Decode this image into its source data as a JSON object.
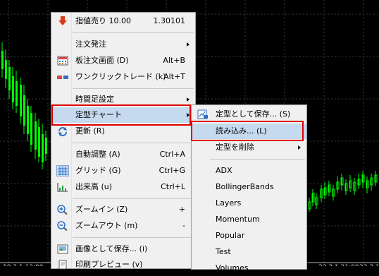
{
  "colors": {
    "chart_bg": "#000000",
    "candle": "#00ff00",
    "menu_bg": "#f0f0f0",
    "highlight": "#c5d9ef",
    "callout": "#e00000"
  },
  "main_menu": {
    "items": [
      {
        "label": "指値売り 10.00",
        "shortcut": "1.30101",
        "icon": "red-down-arrow-icon"
      },
      {
        "label": "注文発注",
        "submenu": true
      },
      {
        "label": "板注文画面 (D)",
        "shortcut": "Alt+B",
        "icon": "order-board-icon"
      },
      {
        "label": "ワンクリックトレード (k)",
        "shortcut": "Alt+T",
        "icon": "one-click-trade-icon"
      },
      {
        "label": "時間足設定",
        "submenu": true
      },
      {
        "label": "定型チャート",
        "submenu": true,
        "highlighted": true
      },
      {
        "label": "更新 (R)",
        "icon": "refresh-icon"
      },
      {
        "label": "自動調整 (A)",
        "shortcut": "Ctrl+A"
      },
      {
        "label": "グリッド (G)",
        "shortcut": "Ctrl+G",
        "icon": "grid-icon"
      },
      {
        "label": "出来高 (u)",
        "shortcut": "Ctrl+L",
        "icon": "volume-icon"
      },
      {
        "label": "ズームイン (Z)",
        "shortcut": "+",
        "icon": "zoom-in-icon"
      },
      {
        "label": "ズームアウト (m)",
        "shortcut": "-",
        "icon": "zoom-out-icon"
      },
      {
        "label": "画像として保存... (i)",
        "icon": "save-image-icon"
      },
      {
        "label": "印刷プレビュー (v)",
        "icon": "print-preview-icon"
      }
    ]
  },
  "template_menu": {
    "items": [
      {
        "label": "定型として保存... (S)",
        "icon": "save-template-icon"
      },
      {
        "label": "読み込み... (L)",
        "highlighted": true
      },
      {
        "label": "定型を削除",
        "submenu": true
      },
      {
        "label": "ADX"
      },
      {
        "label": "BollingerBands"
      },
      {
        "label": "Layers"
      },
      {
        "label": "Momentum"
      },
      {
        "label": "Popular"
      },
      {
        "label": "Test"
      },
      {
        "label": "Volumes"
      }
    ]
  },
  "axis_labels": [
    "10.2.1 12:00",
    "22.3.1 21:00",
    "22.3.1 2"
  ]
}
